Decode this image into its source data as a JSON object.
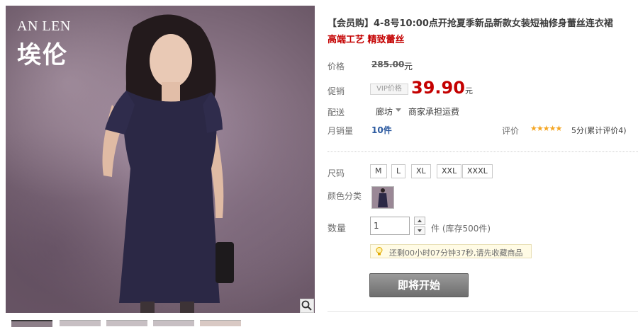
{
  "image": {
    "brand_en": "AN LEN",
    "brand_cn": "埃伦"
  },
  "product": {
    "title": "【会员购】4-8号10:00点开抢夏季新品新款女装短袖修身蕾丝连衣裙",
    "subtitle": "高端工艺 精致蕾丝"
  },
  "pricing": {
    "price_label": "价格",
    "original_price": "285.00",
    "original_unit": "元",
    "promo_label": "促销",
    "vip_tag": "VIP价格",
    "promo_price": "39.90",
    "promo_unit": "元"
  },
  "shipping": {
    "label": "配送",
    "origin": "廊坊",
    "note": "商家承担运费"
  },
  "sales": {
    "label": "月销量",
    "count": "10件",
    "review_label": "评价",
    "stars_text": "★★★★★",
    "stars_value": 5,
    "rating": "5分",
    "review_count": "(累计评价4)"
  },
  "options": {
    "size_label": "尺码",
    "sizes": [
      "M",
      "L",
      "XL",
      "XXL",
      "XXXL"
    ],
    "color_label": "颜色分类"
  },
  "quantity": {
    "label": "数量",
    "value": "1",
    "stock_text": "件 (库存500件)"
  },
  "notice": {
    "text": "还剩00小时07分钟37秒,请先收藏商品"
  },
  "actions": {
    "buy_label": "即将开始"
  },
  "colors": {
    "price_red": "#c40000",
    "star_orange": "#f5a623",
    "button_gray": "#7e7e7e"
  }
}
